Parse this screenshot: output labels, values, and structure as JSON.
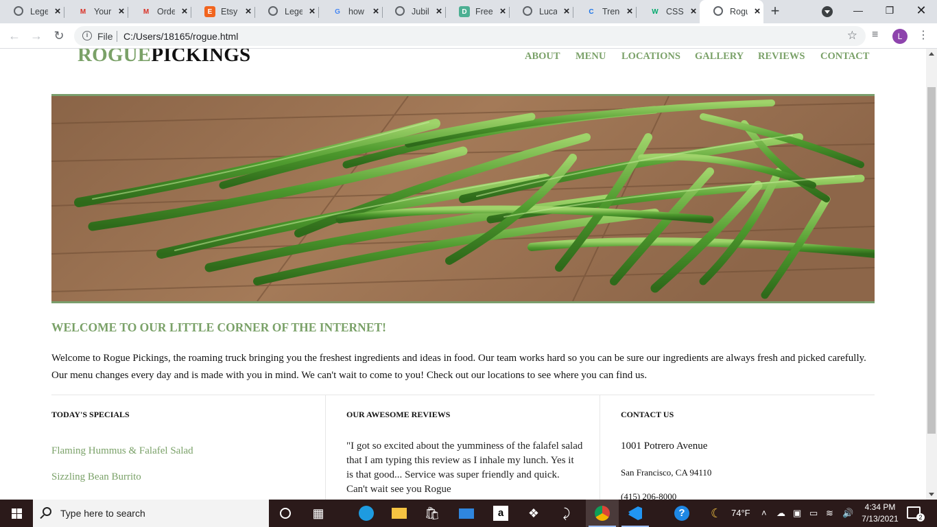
{
  "browser": {
    "tabs": [
      {
        "title": "Legen",
        "icon": "globe-icon",
        "color": "#5f6368"
      },
      {
        "title": "Your",
        "icon": "gmail-icon",
        "color": "#d93025"
      },
      {
        "title": "Orde",
        "icon": "gmail-icon",
        "color": "#d93025"
      },
      {
        "title": "Etsy -",
        "icon": "etsy-icon",
        "color": "#f1641e"
      },
      {
        "title": "Legen",
        "icon": "globe-icon",
        "color": "#5f6368"
      },
      {
        "title": "how t",
        "icon": "google-icon",
        "color": "#4285f4"
      },
      {
        "title": "Jubile",
        "icon": "globe-icon",
        "color": "#5f6368"
      },
      {
        "title": "Free",
        "icon": "d-icon",
        "color": "#4caf93"
      },
      {
        "title": "Lucas",
        "icon": "globe-icon",
        "color": "#5f6368"
      },
      {
        "title": "Trenc",
        "icon": "c-icon",
        "color": "#1a73e8"
      },
      {
        "title": "CSS I",
        "icon": "w-icon",
        "color": "#04aa6d"
      },
      {
        "title": "Rogu",
        "icon": "globe-icon",
        "color": "#5f6368"
      }
    ],
    "url_scheme": "File",
    "url": "C:/Users/18165/rogue.html",
    "avatar_letter": "L"
  },
  "site": {
    "logo_part1": "ROGUE",
    "logo_part2": "PICKINGS",
    "nav": [
      "ABOUT",
      "MENU",
      "LOCATIONS",
      "GALLERY",
      "REVIEWS",
      "CONTACT"
    ],
    "welcome_title": "WELCOME TO OUR LITTLE CORNER OF THE INTERNET!",
    "welcome_text": "Welcome to Rogue Pickings, the roaming truck bringing you the freshest ingredients and ideas in food. Our team works hard so you can be sure our ingredients are always fresh and picked carefully. Our menu changes every day and is made with you in mind. We can't wait to come to you! Check out our locations to see where you can find us.",
    "specials": {
      "heading": "TODAY'S SPECIALS",
      "items": [
        "Flaming Hummus & Falafel Salad",
        "Sizzling Bean Burrito"
      ]
    },
    "reviews": {
      "heading": "OUR AWESOME REVIEWS",
      "text": "\"I got so excited about the yumminess of the falafel salad that I am typing this review as I inhale my lunch. Yes it is that good... Service was super friendly and quick. Can't wait see you Rogue"
    },
    "contact": {
      "heading": "CONTACT US",
      "street": "1001 Potrero Avenue",
      "city": "San Francisco, CA 94110",
      "phone": "(415) 206-8000"
    }
  },
  "taskbar": {
    "search_placeholder": "Type here to search",
    "weather": "74°F",
    "time": "4:34 PM",
    "date": "7/13/2021",
    "notification_count": "2"
  }
}
